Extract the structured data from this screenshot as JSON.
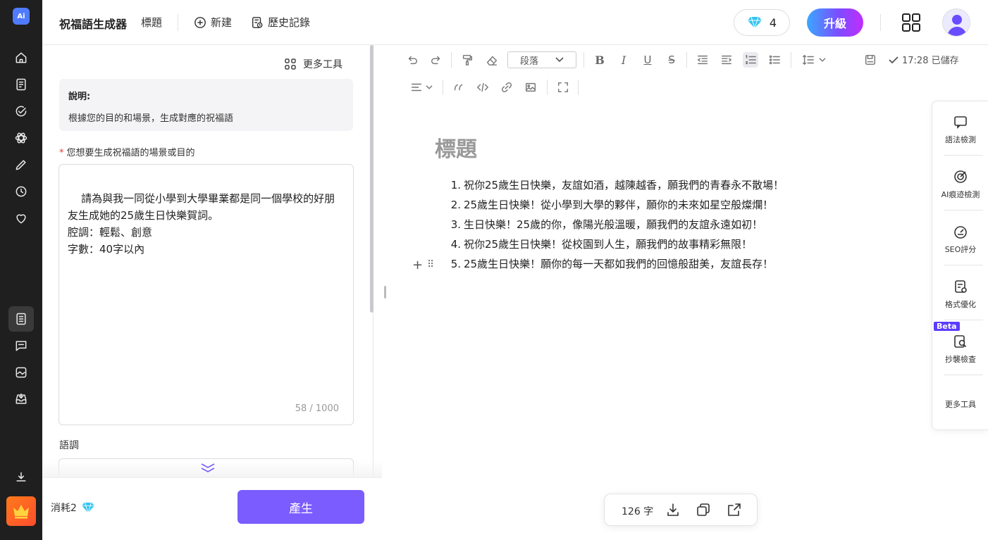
{
  "rail": {
    "logo": "Ai",
    "items": [
      "home-icon",
      "document-icon",
      "check-circle-icon",
      "atom-icon",
      "pencil-icon",
      "history-icon",
      "heart-icon",
      "notebook-icon",
      "message-icon",
      "image-icon",
      "inbox-icon",
      "download-icon",
      "crown-icon"
    ]
  },
  "topbar": {
    "app_title": "祝福語生成器",
    "doc_title": "標題",
    "new_label": "新建",
    "history_label": "歷史記錄",
    "gems": "4",
    "upgrade_label": "升級"
  },
  "panel": {
    "more_tools": "更多工具",
    "note_heading": "說明:",
    "note_text": "根據您的目的和場景，生成對應的祝福語",
    "required_mark": "*",
    "field_label": "您想要生成祝福語的場景或目的",
    "field_value": "請為與我一同從小學到大學畢業都是同一個學校的好朋\n友生成她的25歲生日快樂賀詞。\n腔調：輕鬆、創意\n字數：40字以內",
    "counter": "58 / 1000",
    "tone_label": "語調",
    "cost_label": "消耗2",
    "generate_label": "產生"
  },
  "editor": {
    "paragraph_select": "段落",
    "saved_status": "17:28 已儲存",
    "heading": "標題",
    "items": [
      {
        "n": "1.",
        "text": "祝你25歲生日快樂，友誼如酒，越陳越香，願我們的青春永不散場！"
      },
      {
        "n": "2.",
        "text": "25歲生日快樂！從小學到大學的夥伴，願你的未來如星空般燦爛！"
      },
      {
        "n": "3.",
        "text": "生日快樂！25歲的你，像陽光般溫暖，願我們的友誼永遠如初！"
      },
      {
        "n": "4.",
        "text": "祝你25歲生日快樂！從校園到人生，願我們的故事精彩無限！"
      },
      {
        "n": "5.",
        "text": "25歲生日快樂！願你的每一天都如我們的回憶般甜美，友誼長存！"
      }
    ]
  },
  "right_tools": {
    "grammar": "語法檢測",
    "ai_detect": "AI痕迹檢測",
    "seo": "SEO評分",
    "format": "格式優化",
    "beta": "Beta",
    "plagiarism": "抄襲檢查",
    "more": "更多工具"
  },
  "bottom": {
    "word_count": "126 字"
  }
}
